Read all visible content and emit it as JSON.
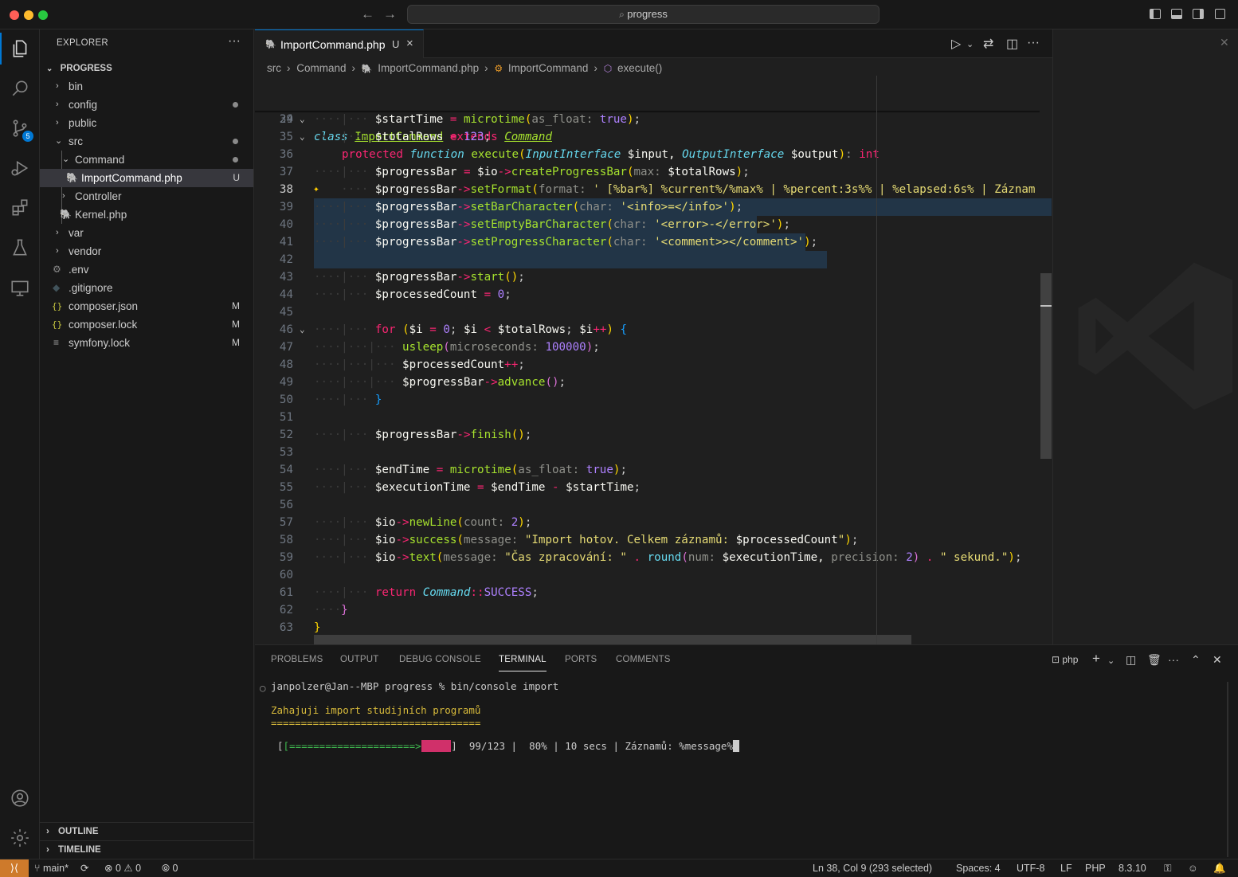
{
  "titlebar": {
    "search_text": "progress",
    "back": "←",
    "forward": "→"
  },
  "activity": {
    "scm_badge": "5"
  },
  "sidebar": {
    "title": "EXPLORER",
    "more": "···",
    "root": "PROGRESS",
    "items": [
      {
        "label": "bin",
        "decoration": ""
      },
      {
        "label": "config",
        "decoration": ""
      },
      {
        "label": "public",
        "decoration": ""
      },
      {
        "label": "src",
        "decoration": ""
      },
      {
        "label": "Command",
        "decoration": ""
      },
      {
        "label": "ImportCommand.php",
        "decoration": "U"
      },
      {
        "label": "Controller",
        "decoration": ""
      },
      {
        "label": "Kernel.php",
        "decoration": ""
      },
      {
        "label": "var",
        "decoration": ""
      },
      {
        "label": "vendor",
        "decoration": ""
      },
      {
        "label": ".env",
        "decoration": ""
      },
      {
        "label": ".gitignore",
        "decoration": ""
      },
      {
        "label": "composer.json",
        "decoration": "M"
      },
      {
        "label": "composer.lock",
        "decoration": "M"
      },
      {
        "label": "symfony.lock",
        "decoration": "M"
      }
    ],
    "outline": "OUTLINE",
    "timeline": "TIMELINE"
  },
  "editor": {
    "tab": {
      "label": "ImportCommand.php",
      "status": "U",
      "close": "×"
    },
    "breadcrumb": [
      "src",
      "Command",
      "ImportCommand.php",
      "ImportCommand",
      "execute()"
    ],
    "sticky": {
      "line16_num": "16",
      "line29_num": "29",
      "class": "class",
      "class_name": "ImportCommand",
      "extends": "extends",
      "parent": "Command",
      "protected": "protected",
      "function": "function",
      "method": "execute",
      "t1": "InputInterface",
      "v1": "$input,",
      "t2": "OutputInterface",
      "v2": "$output",
      "ret": "int"
    },
    "line_numbers": [
      "34",
      "35",
      "36",
      "37",
      "38",
      "39",
      "40",
      "41",
      "42",
      "43",
      "44",
      "45",
      "46",
      "47",
      "48",
      "49",
      "50",
      "51",
      "52",
      "53",
      "54",
      "55",
      "56",
      "57",
      "58",
      "59",
      "60",
      "61",
      "62",
      "63"
    ],
    "code": {
      "l34_v": "$startTime",
      "l34_f": "microtime",
      "l34_p": "as_float:",
      "l34_a": "true",
      "l35_v": "$totalRows",
      "l35_n": "123",
      "l37_v": "$progressBar",
      "l37_io": "$io",
      "l37_f": "createProgressBar",
      "l37_p": "max:",
      "l37_a": "$totalRows",
      "l38_v": "$progressBar",
      "l38_f": "setFormat",
      "l38_p": "format:",
      "l38_s": "' [%bar%] %current%/%max% | %percent:3s%% | %elapsed:6s% | Záznam",
      "l39_v": "$progressBar",
      "l39_f": "setBarCharacter",
      "l39_p": "char:",
      "l39_s": "'<info>=</info>'",
      "l40_v": "$progressBar",
      "l40_f": "setEmptyBarCharacter",
      "l40_p": "char:",
      "l40_s": "'<error>-</error>'",
      "l41_v": "$progressBar",
      "l41_f": "setProgressCharacter",
      "l41_p": "char:",
      "l41_s": "'<comment>></comment>'",
      "l43_v": "$progressBar",
      "l43_f": "start",
      "l44_v": "$processedCount",
      "l44_n": "0",
      "l46_for": "for",
      "l46_i": "$i",
      "l46_n": "0",
      "l46_i2": "$i",
      "l46_t": "$totalRows",
      "l46_i3": "$i",
      "l47_f": "usleep",
      "l47_p": "microseconds:",
      "l47_n": "100000",
      "l48_v": "$processedCount",
      "l49_v": "$progressBar",
      "l49_f": "advance",
      "l52_v": "$progressBar",
      "l52_f": "finish",
      "l54_v": "$endTime",
      "l54_f": "microtime",
      "l54_p": "as_float:",
      "l54_a": "true",
      "l55_v": "$executionTime",
      "l55_a": "$endTime",
      "l55_b": "$startTime",
      "l57_io": "$io",
      "l57_f": "newLine",
      "l57_p": "count:",
      "l57_n": "2",
      "l58_io": "$io",
      "l58_f": "success",
      "l58_p": "message:",
      "l58_s": "\"Import hotov. Celkem záznamů: ",
      "l58_iv": "$processedCount",
      "l58_e": "\"",
      "l59_io": "$io",
      "l59_f": "text",
      "l59_p": "message:",
      "l59_s": "\"Čas zpracování: \"",
      "l59_f2": "round",
      "l59_p2": "num:",
      "l59_v": "$executionTime,",
      "l59_p3": "precision:",
      "l59_n": "2",
      "l59_s2": "\" sekund.\"",
      "l61_r": "return",
      "l61_c": "Command",
      "l61_k": "SUCCESS"
    }
  },
  "panel": {
    "tabs": [
      "PROBLEMS",
      "OUTPUT",
      "DEBUG CONSOLE",
      "TERMINAL",
      "PORTS",
      "COMMENTS"
    ],
    "shell": "php",
    "terminal": {
      "prompt": "janpolzer@Jan--MBP progress % bin/console import",
      "heading": "Zahajuji import studijních programů",
      "underline": "===================================",
      "bar_done": "[=====================>",
      "bar_empty": "-----",
      "bar_end": "]",
      "stats": "  99/123 |  80% | 10 secs | Záznamů: %message%",
      "progress_fraction": 0.8
    }
  },
  "statusbar": {
    "branch": "main*",
    "errors": "0",
    "warnings": "0",
    "ports": "0",
    "position": "Ln 38, Col 9 (293 selected)",
    "spaces": "Spaces: 4",
    "encoding": "UTF-8",
    "eol": "LF",
    "language": "PHP",
    "version": "8.3.10"
  },
  "colors": {
    "accent": "#0078d4",
    "remote": "#ce7a2b"
  }
}
